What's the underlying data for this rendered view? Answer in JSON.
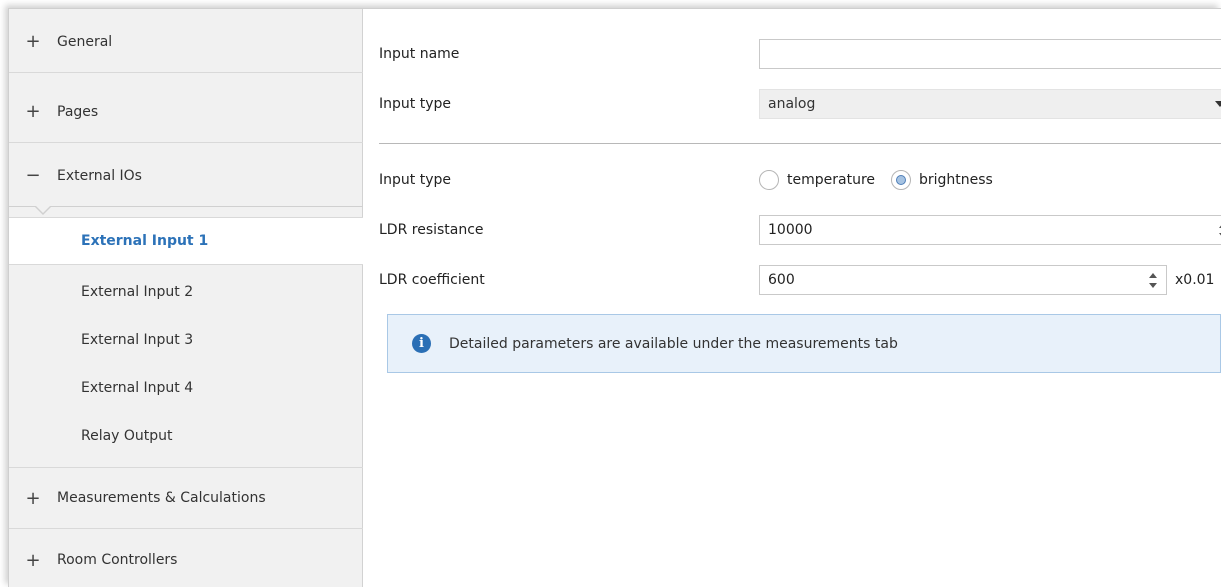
{
  "sidebar": {
    "sections": [
      {
        "sign": "+",
        "label": "General"
      },
      {
        "sign": "+",
        "label": "Pages"
      },
      {
        "sign": "−",
        "label": "External IOs"
      },
      {
        "sign": "+",
        "label": "Measurements & Calculations"
      },
      {
        "sign": "+",
        "label": "Room Controllers"
      }
    ],
    "sub_items": [
      {
        "label": "External Input 1",
        "active": true
      },
      {
        "label": "External Input 2"
      },
      {
        "label": "External Input 3"
      },
      {
        "label": "External Input 4"
      },
      {
        "label": "Relay Output"
      }
    ]
  },
  "form": {
    "input_name": {
      "label": "Input name",
      "value": ""
    },
    "input_type": {
      "label": "Input type",
      "selected": "analog"
    },
    "analog_type": {
      "label": "Input type",
      "options": [
        "temperature",
        "brightness"
      ],
      "selected": "brightness"
    },
    "ldr_resistance": {
      "label": "LDR resistance",
      "value": "10000"
    },
    "ldr_coefficient": {
      "label": "LDR coefficient",
      "value": "600",
      "unit": "x0.01"
    }
  },
  "info": {
    "icon": "info-icon",
    "text": "Detailed parameters are available under the measurements tab"
  },
  "colors": {
    "active_text": "#2c72b8",
    "info_background": "#e8f1fa",
    "info_border": "#a9c8e6",
    "info_icon": "#2a6fb5"
  }
}
